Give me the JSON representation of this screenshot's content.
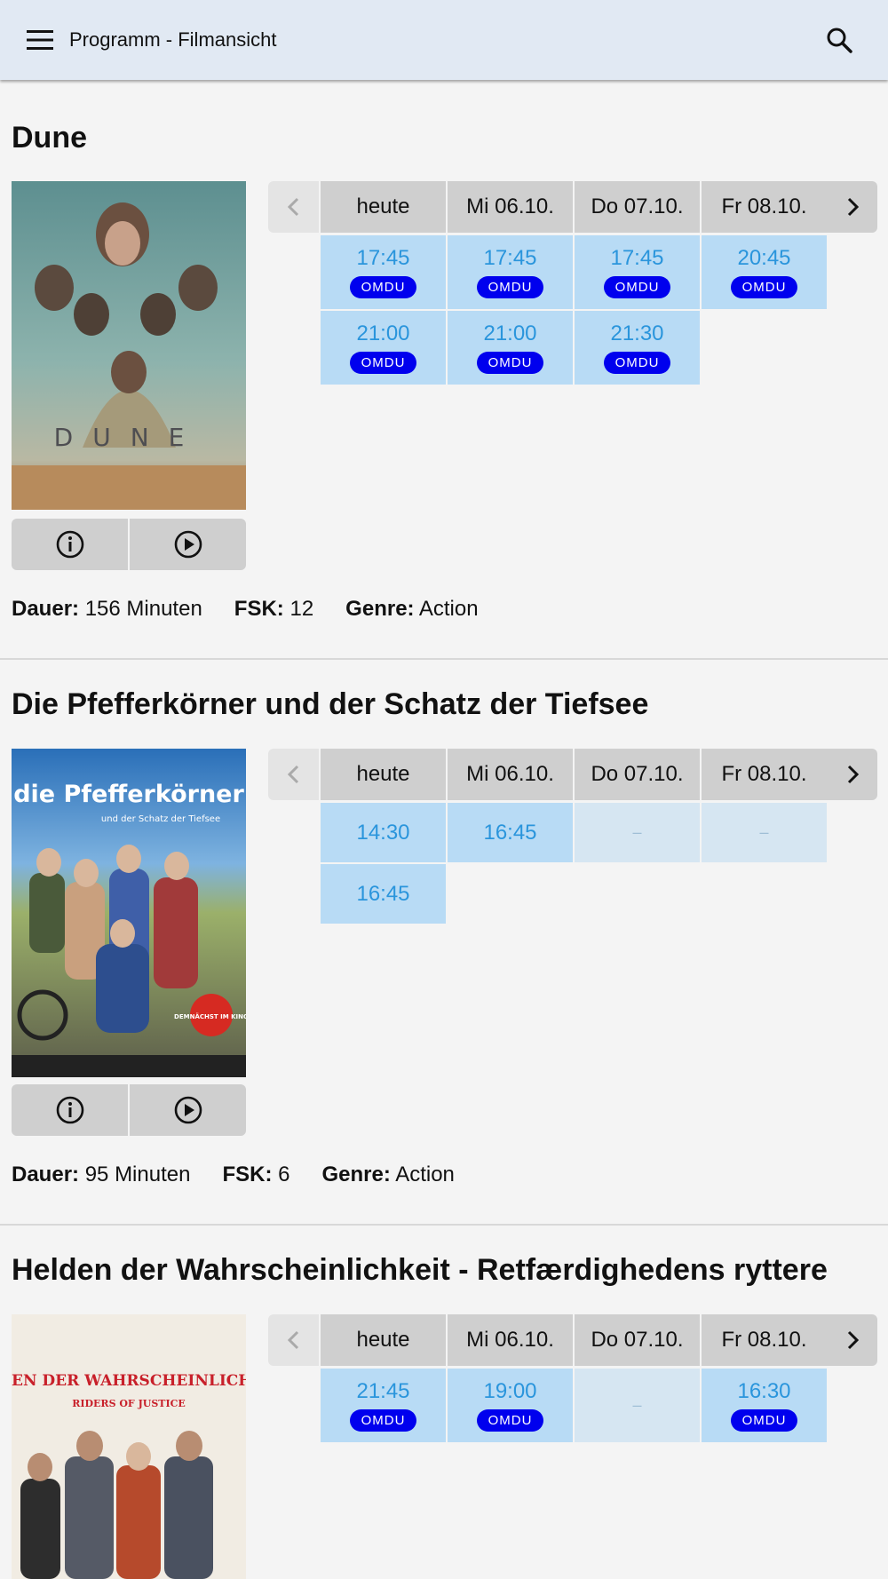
{
  "appbar": {
    "title": "Programm - Filmansicht"
  },
  "films": [
    {
      "title": "Dune",
      "days": [
        "heute",
        "Mi 06.10.",
        "Do 07.10.",
        "Fr 08.10."
      ],
      "meta": {
        "dauer_label": "Dauer:",
        "dauer": "156 Minuten",
        "fsk_label": "FSK:",
        "fsk": "12",
        "genre_label": "Genre:",
        "genre": "Action"
      },
      "rows": [
        [
          {
            "time": "17:45",
            "badge": "OMDU"
          },
          {
            "time": "17:45",
            "badge": "OMDU"
          },
          {
            "time": "17:45",
            "badge": "OMDU"
          },
          {
            "time": "20:45",
            "badge": "OMDU"
          }
        ],
        [
          {
            "time": "21:00",
            "badge": "OMDU"
          },
          {
            "time": "21:00",
            "badge": "OMDU"
          },
          {
            "time": "21:30",
            "badge": "OMDU"
          }
        ]
      ],
      "poster": {
        "word": "DUNE"
      }
    },
    {
      "title": "Die Pfefferkörner und der Schatz der Tiefsee",
      "days": [
        "heute",
        "Mi 06.10.",
        "Do 07.10.",
        "Fr 08.10."
      ],
      "meta": {
        "dauer_label": "Dauer:",
        "dauer": "95 Minuten",
        "fsk_label": "FSK:",
        "fsk": "6",
        "genre_label": "Genre:",
        "genre": "Action"
      },
      "rows": [
        [
          {
            "time": "14:30"
          },
          {
            "time": "16:45"
          },
          {
            "time": "–",
            "empty": true
          },
          {
            "time": "–",
            "empty": true
          }
        ],
        [
          {
            "time": "16:45"
          }
        ]
      ],
      "poster": {
        "word": "die Pfefferkörner",
        "sub": "und der Schatz der Tiefsee",
        "sticker": "DEMNÄCHST IM KINO"
      }
    },
    {
      "title": "Helden der Wahrscheinlichkeit - Retfærdighedens ryttere",
      "days": [
        "heute",
        "Mi 06.10.",
        "Do 07.10.",
        "Fr 08.10."
      ],
      "meta": {},
      "rows": [
        [
          {
            "time": "21:45",
            "badge": "OMDU"
          },
          {
            "time": "19:00",
            "badge": "OMDU"
          },
          {
            "time": "–",
            "empty": true
          },
          {
            "time": "16:30",
            "badge": "OMDU"
          }
        ]
      ],
      "poster": {
        "word": "HELDEN DER WAHRSCHEINLICHKEIT",
        "sub": "RIDERS OF JUSTICE"
      }
    }
  ]
}
